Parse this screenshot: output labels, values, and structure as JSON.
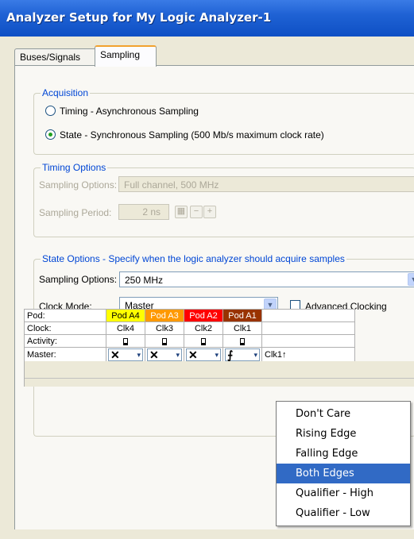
{
  "window": {
    "title": "Analyzer Setup for My Logic Analyzer-1"
  },
  "tabs": [
    {
      "label": "Buses/Signals"
    },
    {
      "label": "Sampling"
    }
  ],
  "acquisition": {
    "title": "Acquisition",
    "options": [
      {
        "label": "Timing - Asynchronous Sampling",
        "checked": false
      },
      {
        "label": "State - Synchronous Sampling (500 Mb/s maximum clock rate)",
        "checked": true
      }
    ]
  },
  "timing": {
    "title": "Timing Options",
    "sampling_options_label": "Sampling Options:",
    "sampling_options_value": "Full channel, 500 MHz",
    "sampling_period_label": "Sampling Period:",
    "sampling_period_value": "2 ns",
    "minus": "−",
    "plus": "+"
  },
  "state": {
    "title": "State Options - Specify when the logic analyzer should acquire samples",
    "sampling_options_label": "Sampling Options:",
    "sampling_options_value": "250 MHz",
    "clock_mode_label": "Clock Mode:",
    "clock_mode_value": "Master",
    "advanced_clocking_label": "Advanced Clocking",
    "advanced_clocking_checked": false
  },
  "pod_grid": {
    "row_labels": {
      "pod": "Pod:",
      "clock": "Clock:",
      "activity": "Activity:",
      "master": "Master:"
    },
    "pods": [
      {
        "name": "Pod A4",
        "clock": "Clk4",
        "color": "#ffff00",
        "text_color": "#000000",
        "master": "✕"
      },
      {
        "name": "Pod A3",
        "clock": "Clk3",
        "color": "#ff9900",
        "text_color": "#ffffff",
        "master": "✕"
      },
      {
        "name": "Pod A2",
        "clock": "Clk2",
        "color": "#ff0000",
        "text_color": "#ffffff",
        "master": "✕"
      },
      {
        "name": "Pod A1",
        "clock": "Clk1",
        "color": "#993300",
        "text_color": "#ffffff",
        "master": "⨍"
      }
    ],
    "master_summary": "Clk1↑"
  },
  "edge_menu": {
    "items": [
      {
        "label": "Don't Care",
        "highlighted": false
      },
      {
        "label": "Rising Edge",
        "highlighted": false
      },
      {
        "label": "Falling Edge",
        "highlighted": false
      },
      {
        "label": "Both Edges",
        "highlighted": true
      },
      {
        "label": "Qualifier - High",
        "highlighted": false
      },
      {
        "label": "Qualifier - Low",
        "highlighted": false
      }
    ]
  },
  "icons": {
    "combo_arrow": "chevron-down-icon",
    "radio": "radio-icon",
    "activity": "activity-icon",
    "master_dropdown": "double-chevron-down-icon"
  }
}
